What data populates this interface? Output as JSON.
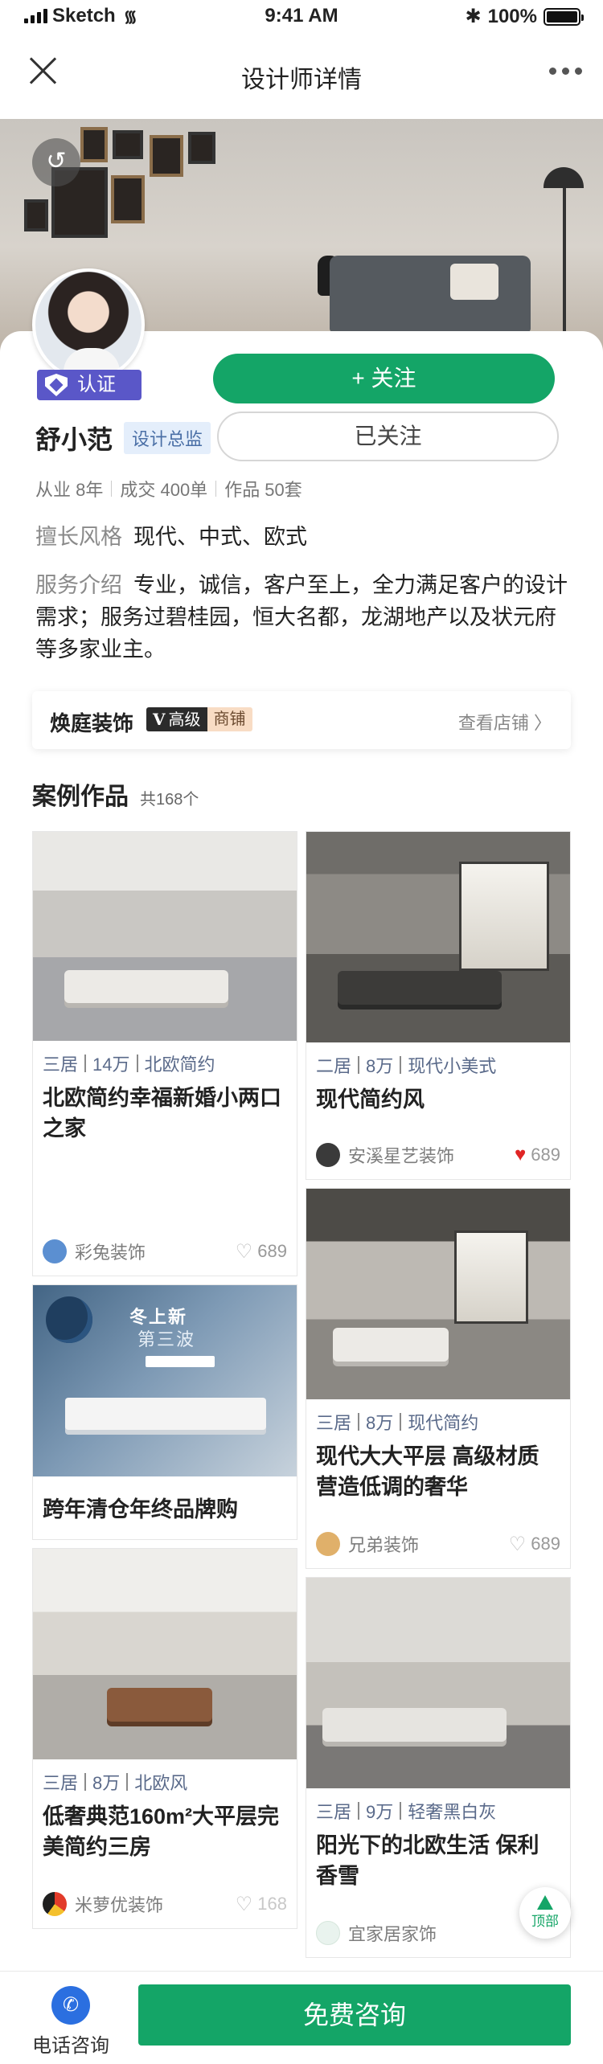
{
  "status_bar": {
    "carrier": "Sketch",
    "time": "9:41 AM",
    "battery": "100%",
    "battery_level": 1.0
  },
  "nav": {
    "title": "设计师详情"
  },
  "designer": {
    "name": "舒小范",
    "title": "设计总监",
    "verified_label": "认证",
    "stats": [
      "从业 8年",
      "成交 400单",
      "作品 50套"
    ],
    "style_label": "擅长风格",
    "style_value": "现代、中式、欧式",
    "service_label": "服务介绍",
    "service_value": "专业，诚信，客户至上，全力满足客户的设计需求；服务过碧桂园，恒大名都，龙湖地产以及状元府等多家业主。"
  },
  "actions": {
    "follow": "+ 关注",
    "followed": "已关注"
  },
  "shop": {
    "name": "焕庭装饰",
    "level_letter": "V",
    "level": "高级",
    "type": "商铺",
    "view": "查看店铺 〉"
  },
  "cases_section": {
    "title": "案例作品",
    "count": "共168个"
  },
  "cases": [
    {
      "tags": [
        "三居",
        "14万",
        "北欧简约"
      ],
      "title": "北欧简约幸福新婚小两口之家",
      "company": "彩兔装饰",
      "likes": "689",
      "liked": false
    },
    {
      "tags": [
        "二居",
        "8万",
        "现代小美式"
      ],
      "title": "现代简约风",
      "company": "安溪星艺装饰",
      "likes": "689",
      "liked": true
    },
    {
      "promo_line1": "冬上新",
      "promo_line2": "第三波",
      "title": "跨年清仓年终品牌购"
    },
    {
      "tags": [
        "三居",
        "8万",
        "现代简约"
      ],
      "title": "现代大大平层 高级材质营造低调的奢华",
      "company": "兄弟装饰",
      "likes": "689",
      "liked": false
    },
    {
      "tags": [
        "三居",
        "8万",
        "北欧风"
      ],
      "title": "低奢典范160m²大平层完美简约三房",
      "company": "米萝优装饰",
      "likes": "168",
      "liked": false
    },
    {
      "tags": [
        "三居",
        "9万",
        "轻奢黑白灰"
      ],
      "title": "阳光下的北欧生活 保利香雪",
      "company": "宜家居家饰"
    }
  ],
  "to_top": "顶部",
  "bottom": {
    "phone_label": "电话咨询",
    "consult": "免费咨询"
  },
  "colors": {
    "primary_green": "#14a567",
    "verify_purple": "#5a57c8",
    "phone_blue": "#2b6fe0",
    "like_red": "#e02525"
  },
  "icons": [
    "close-icon",
    "more-icon",
    "back-icon",
    "shield-icon",
    "heart-icon",
    "phone-icon",
    "tree-icon"
  ]
}
